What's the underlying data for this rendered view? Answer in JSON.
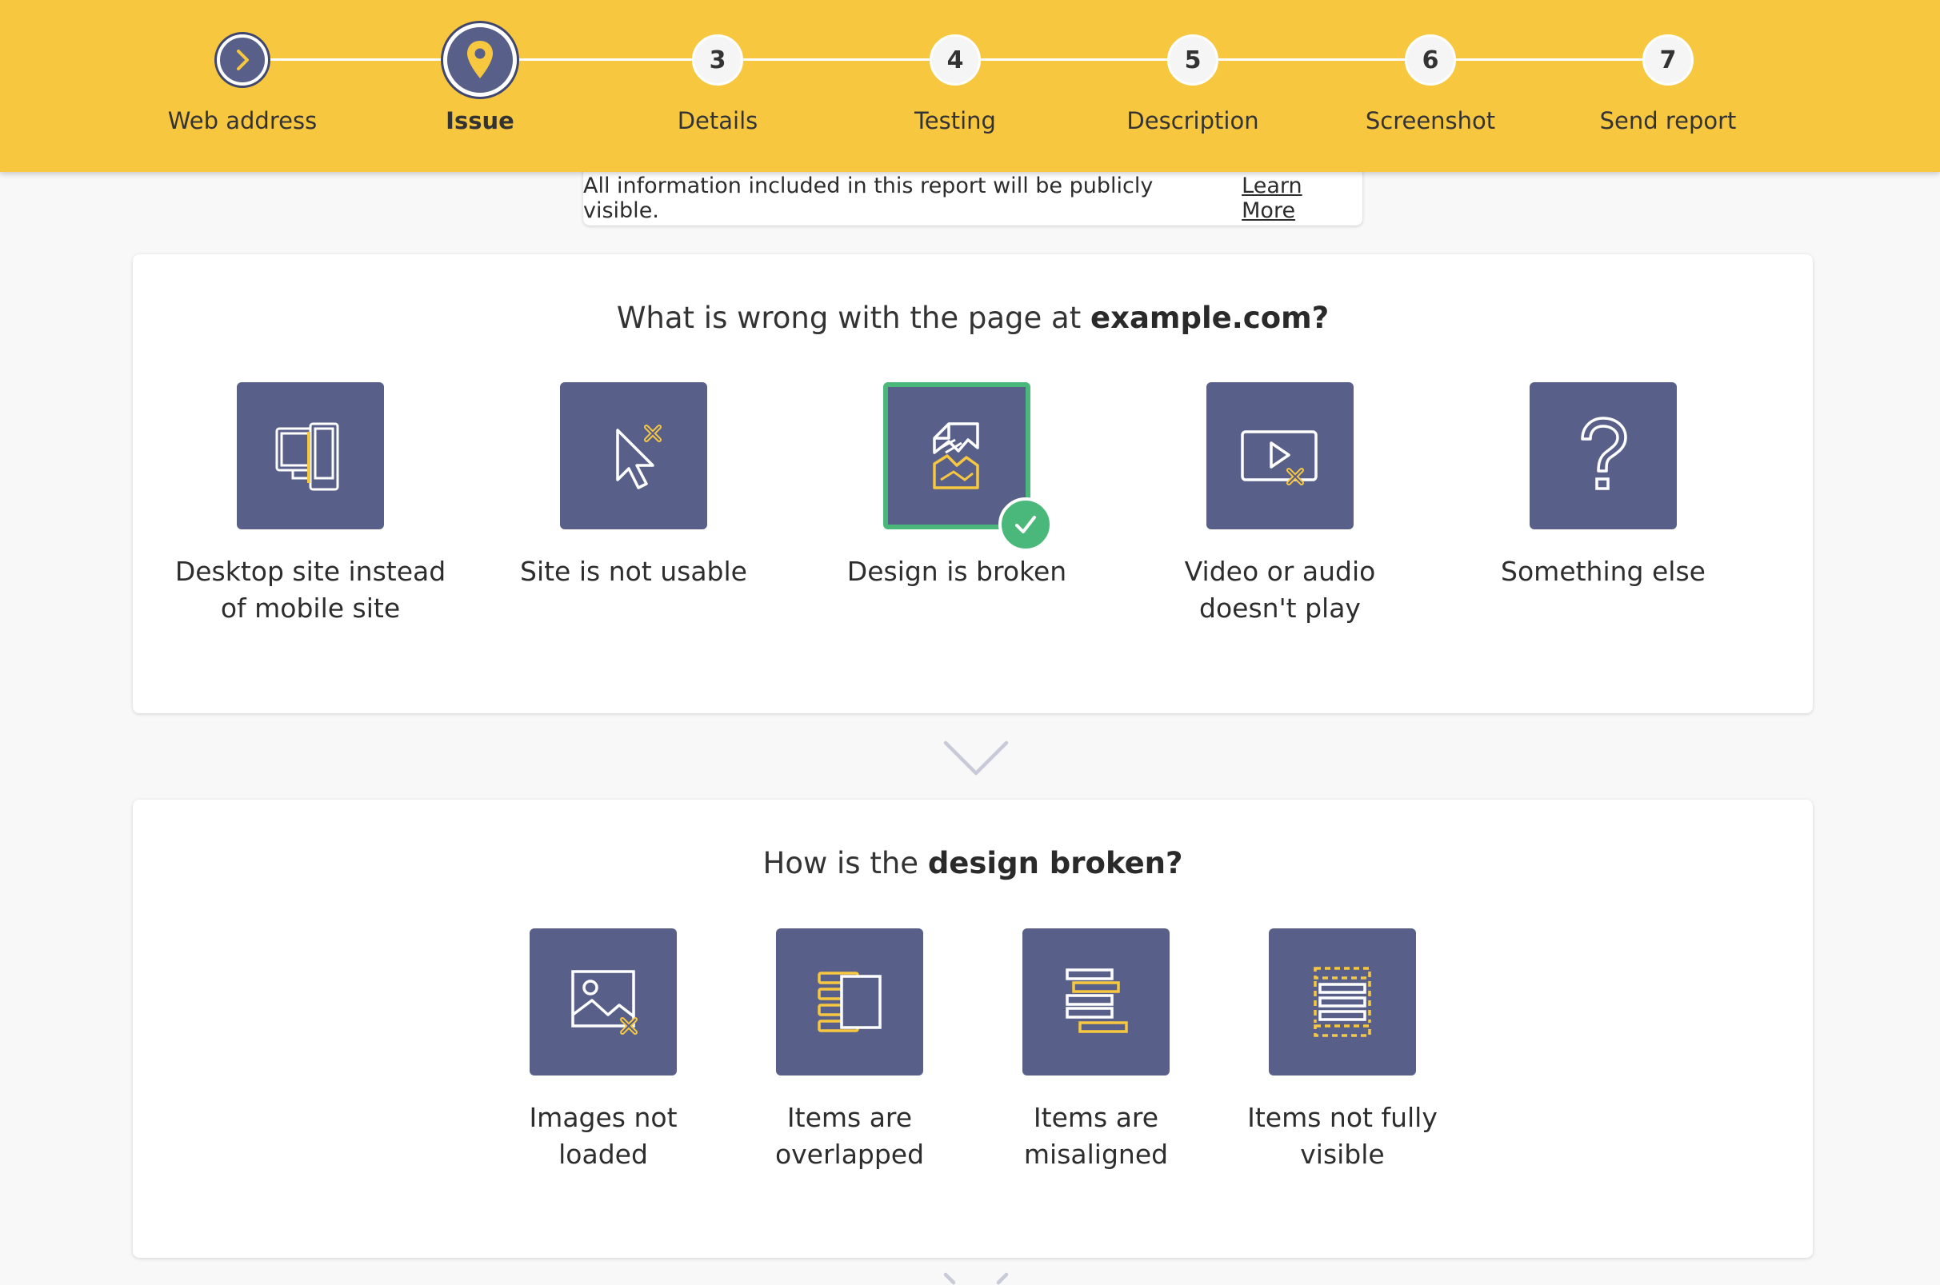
{
  "stepper": {
    "steps": [
      {
        "number": "",
        "label": "Web address",
        "state": "done",
        "icon": "chevron-right-icon"
      },
      {
        "number": "",
        "label": "Issue",
        "state": "active",
        "icon": "location-pin-icon"
      },
      {
        "number": "3",
        "label": "Details",
        "state": "pending"
      },
      {
        "number": "4",
        "label": "Testing",
        "state": "pending"
      },
      {
        "number": "5",
        "label": "Description",
        "state": "pending"
      },
      {
        "number": "6",
        "label": "Screenshot",
        "state": "pending"
      },
      {
        "number": "7",
        "label": "Send report",
        "state": "pending"
      }
    ]
  },
  "notice": {
    "text": "All information included in this report will be publicly visible.",
    "link": "Learn More"
  },
  "issue_section": {
    "title_prefix": "What is wrong with the page at ",
    "title_bold": "example.com?",
    "options": [
      {
        "label_line1": "Desktop site instead",
        "label_line2": "of mobile site",
        "icon": "desktop-mobile-icon",
        "selected": false
      },
      {
        "label_line1": "Site is not usable",
        "label_line2": "",
        "icon": "broken-cursor-icon",
        "selected": false
      },
      {
        "label_line1": "Design is broken",
        "label_line2": "",
        "icon": "broken-page-icon",
        "selected": true
      },
      {
        "label_line1": "Video or audio",
        "label_line2": "doesn't play",
        "icon": "broken-video-icon",
        "selected": false
      },
      {
        "label_line1": "Something else",
        "label_line2": "",
        "icon": "question-mark-icon",
        "selected": false
      }
    ]
  },
  "design_section": {
    "title_prefix": "How is the ",
    "title_bold": "design broken?",
    "options": [
      {
        "label_line1": "Images not",
        "label_line2": "loaded",
        "icon": "broken-image-icon"
      },
      {
        "label_line1": "Items are",
        "label_line2": "overlapped",
        "icon": "overlapped-items-icon"
      },
      {
        "label_line1": "Items are",
        "label_line2": "misaligned",
        "icon": "misaligned-items-icon"
      },
      {
        "label_line1": "Items not fully",
        "label_line2": "visible",
        "icon": "hidden-items-icon"
      }
    ]
  },
  "colors": {
    "header": "#f8c740",
    "tile": "#58608a",
    "selected": "#4ab87a",
    "icon_accent": "#f8c740"
  }
}
